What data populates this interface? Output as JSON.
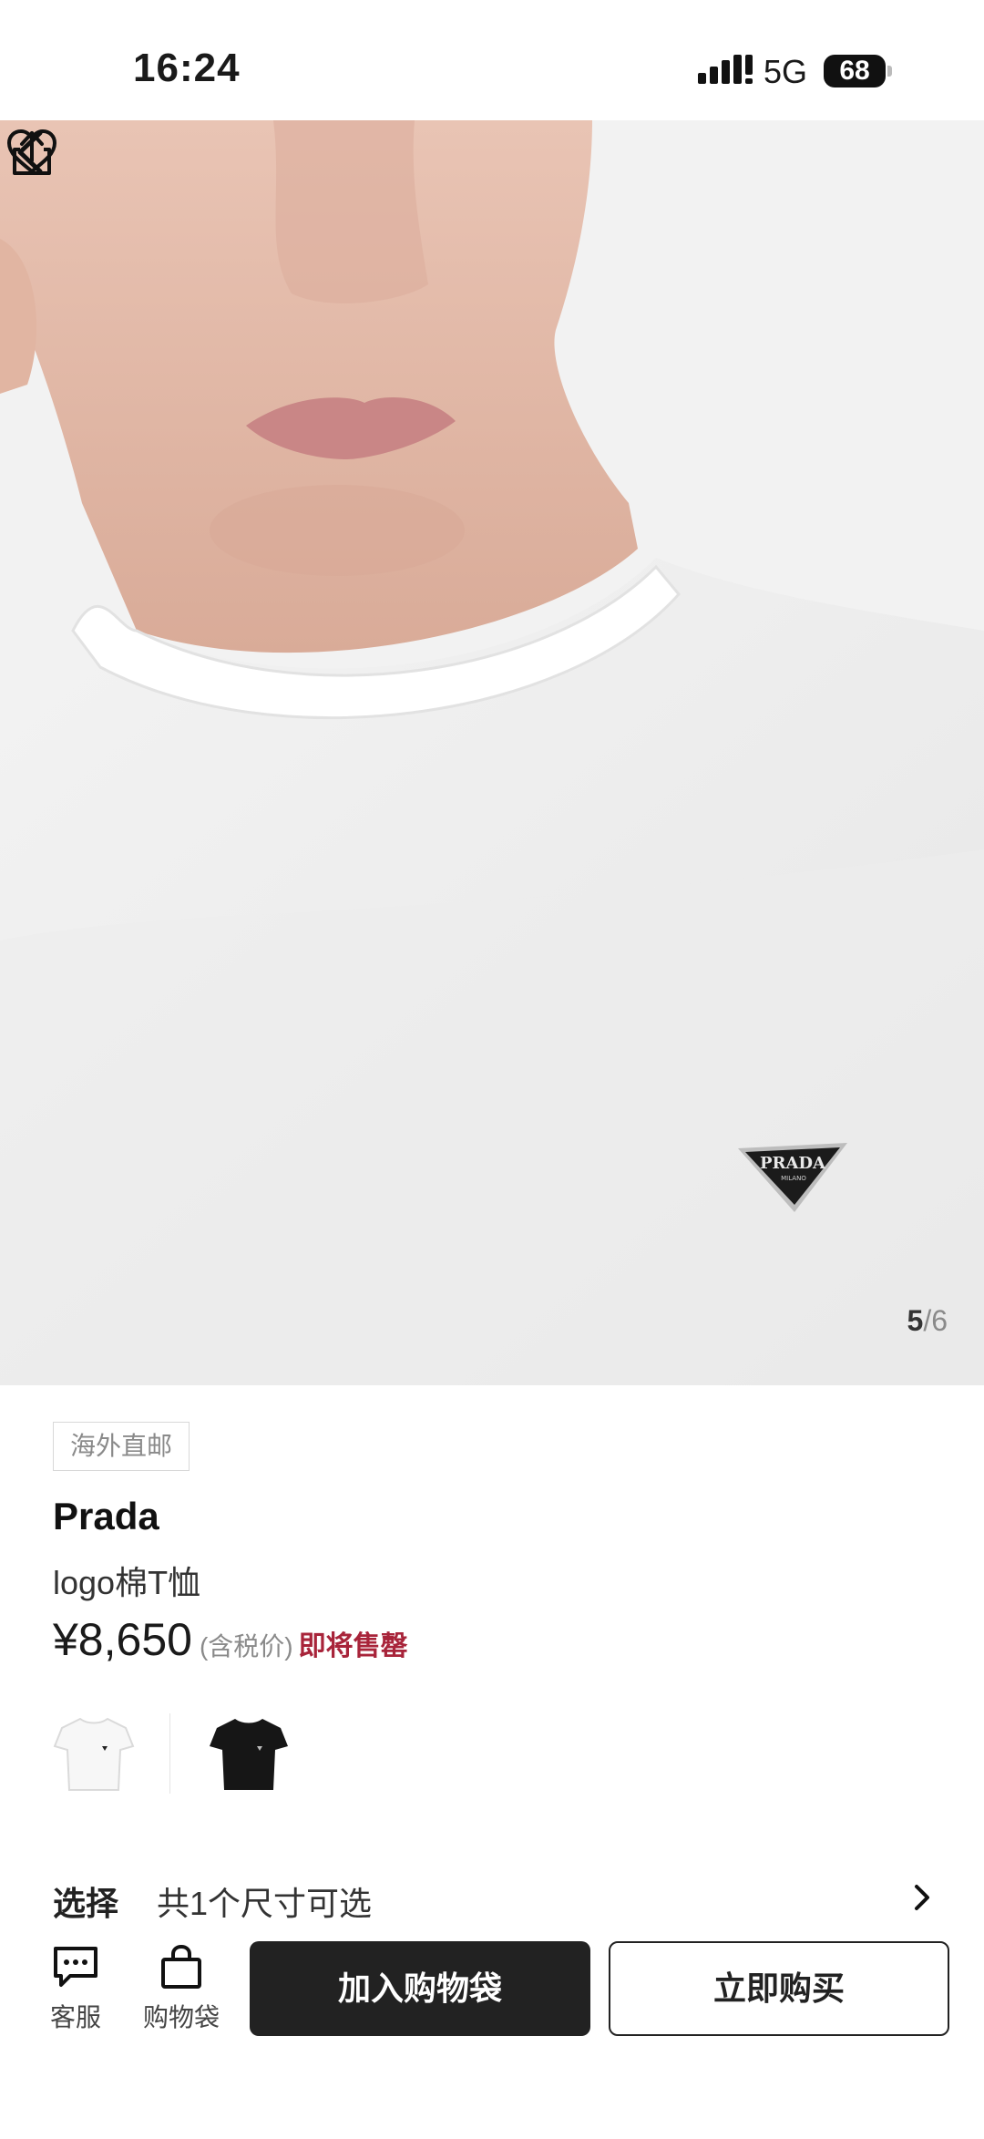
{
  "status_bar": {
    "time": "16:24",
    "network": "5G",
    "battery": "68"
  },
  "hero": {
    "image_position": "5",
    "image_total": "6",
    "pager_separator": "/",
    "logo_text": "PRADA",
    "logo_subtext": "MILANO"
  },
  "nav": {
    "back_icon": "chevron-left-icon",
    "share_icon": "share-icon",
    "favorite_icon": "heart-icon"
  },
  "product": {
    "tag": "海外直邮",
    "brand": "Prada",
    "name": "logo棉T恤",
    "price": "¥8,650",
    "tax_note": "(含税价)",
    "stock_status": "即将售罄"
  },
  "variants": [
    {
      "color": "white"
    },
    {
      "color": "black"
    }
  ],
  "select": {
    "label": "选择",
    "value": "共1个尺寸可选"
  },
  "bottom_bar": {
    "customer_service_label": "客服",
    "bag_label": "购物袋",
    "add_to_bag": "加入购物袋",
    "buy_now": "立即购买"
  },
  "colors": {
    "accent_red": "#a8243a",
    "primary_dark": "#222222"
  }
}
